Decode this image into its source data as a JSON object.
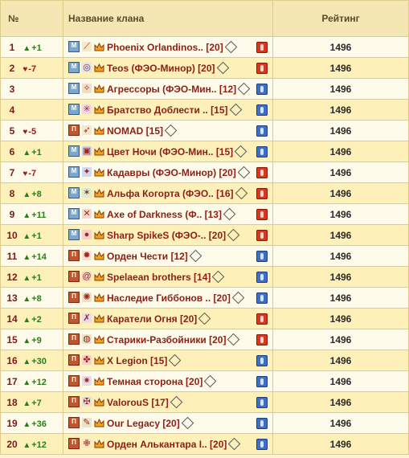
{
  "header": {
    "num": "№",
    "name": "Название клана",
    "rating": "Рейтинг"
  },
  "rows": [
    {
      "pos": "1",
      "dir": "up",
      "change": "+1",
      "align": "М",
      "emblem": "feather",
      "name": "Phoenix Orlandinos.. [20]",
      "tier": "fire",
      "rating": "1496"
    },
    {
      "pos": "2",
      "dir": "down",
      "change": "-7",
      "align": "М",
      "emblem": "swirl",
      "name": "Teos (ФЭО-Минор) [20]",
      "tier": "fire",
      "rating": "1496"
    },
    {
      "pos": "3",
      "dir": "",
      "change": "",
      "align": "М",
      "emblem": "dragon",
      "name": "Агрессоры (ФЭО-Мин.. [12]",
      "tier": "bolt",
      "rating": "1496"
    },
    {
      "pos": "4",
      "dir": "",
      "change": "",
      "align": "М",
      "emblem": "star",
      "name": "Братство Доблести .. [15]",
      "tier": "bolt",
      "rating": "1496"
    },
    {
      "pos": "5",
      "dir": "down",
      "change": "-5",
      "align": "П",
      "emblem": "horse",
      "name": "NOMAD [15]",
      "tier": "bolt",
      "rating": "1496"
    },
    {
      "pos": "6",
      "dir": "up",
      "change": "+1",
      "align": "М",
      "emblem": "shield",
      "name": "Цвет Ночи (ФЭО-Мин.. [15]",
      "tier": "bolt",
      "rating": "1496"
    },
    {
      "pos": "7",
      "dir": "down",
      "change": "-7",
      "align": "М",
      "emblem": "orb",
      "name": "Кадавры (ФЭО-Минор) [20]",
      "tier": "fire",
      "rating": "1496"
    },
    {
      "pos": "8",
      "dir": "up",
      "change": "+8",
      "align": "М",
      "emblem": "beast",
      "name": "Альфа Когорта (ФЭО.. [16]",
      "tier": "fire",
      "rating": "1496"
    },
    {
      "pos": "9",
      "dir": "up",
      "change": "+11",
      "align": "М",
      "emblem": "axes",
      "name": "Axe of Darkness (Ф.. [13]",
      "tier": "fire",
      "rating": "1496"
    },
    {
      "pos": "10",
      "dir": "up",
      "change": "+1",
      "align": "М",
      "emblem": "ball",
      "name": "Sharp SpikeS (ФЭО-.. [20]",
      "tier": "fire",
      "rating": "1496"
    },
    {
      "pos": "11",
      "dir": "up",
      "change": "+14",
      "align": "П",
      "emblem": "sun",
      "name": "Орден Чести [12]",
      "tier": "bolt",
      "rating": "1496"
    },
    {
      "pos": "12",
      "dir": "up",
      "change": "+1",
      "align": "П",
      "emblem": "spiral",
      "name": "Spelaean brothers [14]",
      "tier": "bolt",
      "rating": "1496"
    },
    {
      "pos": "13",
      "dir": "up",
      "change": "+8",
      "align": "П",
      "emblem": "gear",
      "name": "Наследие Гиббонов .. [20]",
      "tier": "bolt",
      "rating": "1496"
    },
    {
      "pos": "14",
      "dir": "up",
      "change": "+2",
      "align": "П",
      "emblem": "swords",
      "name": "Каратели Огня [20]",
      "tier": "fire",
      "rating": "1496"
    },
    {
      "pos": "15",
      "dir": "up",
      "change": "+9",
      "align": "П",
      "emblem": "helm",
      "name": "Старики-Разбойники [20]",
      "tier": "fire",
      "rating": "1496"
    },
    {
      "pos": "16",
      "dir": "up",
      "change": "+30",
      "align": "П",
      "emblem": "claw",
      "name": "X Legion [15]",
      "tier": "bolt",
      "rating": "1496"
    },
    {
      "pos": "17",
      "dir": "up",
      "change": "+12",
      "align": "П",
      "emblem": "spider",
      "name": "Темная сторона [20]",
      "tier": "bolt",
      "rating": "1496"
    },
    {
      "pos": "18",
      "dir": "up",
      "change": "+7",
      "align": "П",
      "emblem": "cross",
      "name": "ValorouS [17]",
      "tier": "bolt",
      "rating": "1496"
    },
    {
      "pos": "19",
      "dir": "up",
      "change": "+36",
      "align": "П",
      "emblem": "wing",
      "name": "Our Legacy [20]",
      "tier": "bolt",
      "rating": "1496"
    },
    {
      "pos": "20",
      "dir": "up",
      "change": "+12",
      "align": "П",
      "emblem": "angel",
      "name": "Орден Алькантара I.. [20]",
      "tier": "bolt",
      "rating": "1496"
    }
  ],
  "colors": {
    "clan_name": "#8b1f16",
    "up": "#2f7a1f",
    "down": "#9b1c1c",
    "header_bg": "#f4e7b3"
  }
}
